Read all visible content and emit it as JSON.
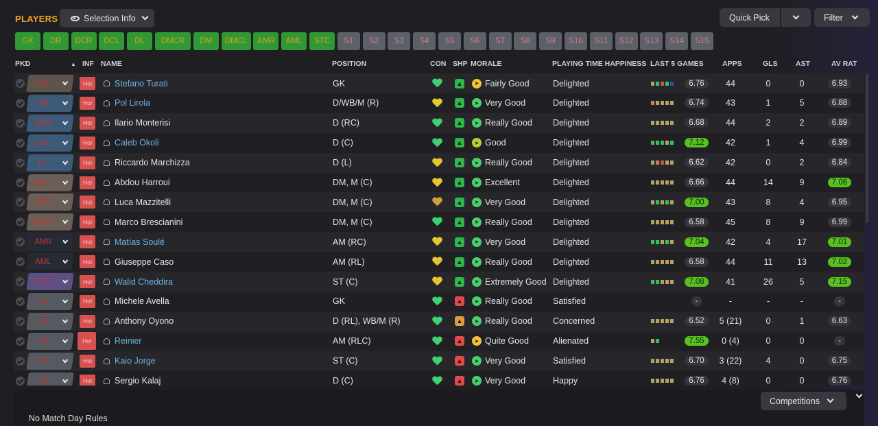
{
  "header": {
    "title": "PLAYERS",
    "selection_info": "Selection Info",
    "quick_pick": "Quick Pick",
    "filter": "Filter"
  },
  "slots": [
    "GK",
    "DR",
    "DCR",
    "DCL",
    "DL",
    "DMCR",
    "DM",
    "DMCL",
    "AMR",
    "AML",
    "STC",
    "S1",
    "S2",
    "S3",
    "S4",
    "S5",
    "S6",
    "S7",
    "S8",
    "S9",
    "S10",
    "S11",
    "S12",
    "S13",
    "S14",
    "S15"
  ],
  "columns": {
    "pkd": "PKD",
    "inf": "INF",
    "name": "NAME",
    "position": "POSITION",
    "con": "CON",
    "shp": "SHP",
    "morale": "MORALE",
    "pth": "PLAYING TIME HAPPINESS",
    "last5": "LAST 5 GAMES",
    "apps": "APPS",
    "gls": "GLS",
    "ast": "AST",
    "avrat": "AV RAT"
  },
  "players": [
    {
      "pkd": "GK",
      "inf": "Hol",
      "name": "Stefano Turati",
      "link": true,
      "position": "GK",
      "con": "g",
      "shp": "g",
      "morale_icon": "y",
      "morale": "Fairly Good",
      "pth": "Delighted",
      "bars": [
        "bt",
        "bg",
        "br",
        "bg",
        "bb"
      ],
      "form": "6.76",
      "apps": "44",
      "gls": "0",
      "ast": "0",
      "avrat": "6.93",
      "pos_bg": "#5e544c"
    },
    {
      "pkd": "DR",
      "inf": "Hol",
      "name": "Pol Lirola",
      "link": true,
      "position": "D/WB/M (R)",
      "con": "y",
      "shp": "g",
      "morale_icon": "g",
      "morale": "Very Good",
      "pth": "Delighted",
      "bars": [
        "bo",
        "bt",
        "bt",
        "bt",
        "bt"
      ],
      "form": "6.74",
      "apps": "43",
      "gls": "1",
      "ast": "5",
      "avrat": "6.88",
      "pos_bg": "#3d5a78"
    },
    {
      "pkd": "DCR",
      "inf": "Hol",
      "name": "Ilario Monterisi",
      "link": false,
      "position": "D (RC)",
      "con": "yg",
      "shp": "g",
      "morale_icon": "g",
      "morale": "Really Good",
      "pth": "Delighted",
      "bars": [
        "bt",
        "bt",
        "bt",
        "bt",
        "bt"
      ],
      "form": "6.68",
      "apps": "44",
      "gls": "2",
      "ast": "2",
      "avrat": "6.89",
      "pos_bg": "#3d5a78"
    },
    {
      "pkd": "DCL",
      "inf": "Hol",
      "name": "Caleb Okoli",
      "link": true,
      "position": "D (C)",
      "con": "g",
      "shp": "g",
      "morale_icon": "yg",
      "morale": "Good",
      "pth": "Delighted",
      "bars": [
        "bg",
        "bg",
        "bg",
        "bt",
        "bg"
      ],
      "form": "7.12",
      "form_hi": true,
      "apps": "42",
      "gls": "1",
      "ast": "4",
      "avrat": "6.99",
      "pos_bg": "#3d5a78"
    },
    {
      "pkd": "DL",
      "inf": "Hol",
      "name": "Riccardo Marchizza",
      "link": false,
      "position": "D (L)",
      "con": "y",
      "shp": "g",
      "morale_icon": "g",
      "morale": "Really Good",
      "pth": "Delighted",
      "bars": [
        "bt",
        "bo",
        "br",
        "bt",
        "bt"
      ],
      "form": "6.62",
      "apps": "42",
      "gls": "0",
      "ast": "2",
      "avrat": "6.84",
      "pos_bg": "#3d5a78"
    },
    {
      "pkd": "DM...",
      "inf": "Hol",
      "name": "Abdou Harroui",
      "link": false,
      "position": "DM, M (C)",
      "con": "y",
      "shp": "g",
      "morale_icon": "g",
      "morale": "Excellent",
      "pth": "Delighted",
      "bars": [
        "bt",
        "bt",
        "bt",
        "bt",
        "bt"
      ],
      "form": "6.66",
      "apps": "44",
      "gls": "14",
      "ast": "9",
      "avrat": "7.06",
      "avrat_hi": true,
      "pos_bg": "#6a5e58"
    },
    {
      "pkd": "DM",
      "inf": "Hol",
      "name": "Luca Mazzitelli",
      "link": false,
      "position": "DM, M (C)",
      "con": "o",
      "shp": "g",
      "morale_icon": "g",
      "morale": "Very Good",
      "pth": "Delighted",
      "bars": [
        "bt",
        "bg",
        "bt",
        "bg",
        "bt"
      ],
      "form": "7.00",
      "form_hi": true,
      "apps": "43",
      "gls": "8",
      "ast": "4",
      "avrat": "6.95",
      "pos_bg": "#6a5e58"
    },
    {
      "pkd": "DMCL",
      "inf": "Hol",
      "name": "Marco Brescianini",
      "link": false,
      "position": "DM, M (C)",
      "con": "yg",
      "shp": "g",
      "morale_icon": "g",
      "morale": "Really Good",
      "pth": "Delighted",
      "bars": [
        "bt",
        "bt",
        "bt",
        "bt",
        "bt"
      ],
      "form": "6.58",
      "apps": "45",
      "gls": "8",
      "ast": "9",
      "avrat": "6.99",
      "pos_bg": "#6a5e58"
    },
    {
      "pkd": "AMR",
      "inf": "Hol",
      "name": "Matías Soulé",
      "link": true,
      "position": "AM (RC)",
      "con": "y",
      "shp": "g",
      "morale_icon": "g",
      "morale": "Very Good",
      "pth": "Delighted",
      "bars": [
        "bg",
        "bg",
        "bt",
        "bg",
        "bt"
      ],
      "form": "7.04",
      "form_hi": true,
      "apps": "42",
      "gls": "4",
      "ast": "17",
      "avrat": "7.01",
      "avrat_hi": true,
      "pos_bg": "#262a34"
    },
    {
      "pkd": "AML",
      "inf": "Hol",
      "name": "Giuseppe Caso",
      "link": false,
      "position": "AM (RL)",
      "con": "y",
      "shp": "g",
      "morale_icon": "g",
      "morale": "Really Good",
      "pth": "Delighted",
      "bars": [
        "bt",
        "bt",
        "bt",
        "bt",
        "bt"
      ],
      "form": "6.58",
      "apps": "44",
      "gls": "11",
      "ast": "13",
      "avrat": "7.02",
      "avrat_hi": true,
      "pos_bg": "#262a34"
    },
    {
      "pkd": "STC",
      "inf": "Hol",
      "name": "Walid Cheddira",
      "link": true,
      "position": "ST (C)",
      "con": "y",
      "shp": "g",
      "morale_icon": "g",
      "morale": "Extremely Good",
      "pth": "Delighted",
      "bars": [
        "bg",
        "bg",
        "bt",
        "bt",
        "bt"
      ],
      "form": "7.08",
      "form_hi": true,
      "apps": "41",
      "gls": "26",
      "ast": "5",
      "avrat": "7.15",
      "avrat_hi": true,
      "pos_bg": "#5e4f82"
    },
    {
      "pkd": "S1",
      "inf": "Hol",
      "name": "Michele Avella",
      "link": false,
      "position": "GK",
      "con": "g",
      "shp": "r",
      "morale_icon": "g",
      "morale": "Really Good",
      "pth": "Satisfied",
      "bars": [],
      "form": "-",
      "apps": "-",
      "gls": "-",
      "ast": "-",
      "avrat": "-",
      "pos_bg": "#555960"
    },
    {
      "pkd": "S2",
      "inf": "Hol",
      "name": "Anthony Oyono",
      "link": false,
      "position": "D (RL), WB/M (R)",
      "con": "g",
      "shp": "o",
      "morale_icon": "g",
      "morale": "Really Good",
      "pth": "Concerned",
      "bars": [
        "bt",
        "bt",
        "bt",
        "bt",
        "bt"
      ],
      "form": "6.52",
      "apps": "5 (21)",
      "gls": "0",
      "ast": "1",
      "avrat": "6.63",
      "pos_bg": "#555960"
    },
    {
      "pkd": "S3",
      "inf": "Hol",
      "name": "Reinier",
      "link": true,
      "position": "AM (RLC)",
      "con": "g",
      "shp": "r",
      "morale_icon": "y",
      "morale": "Quite Good",
      "pth": "Alienated",
      "bars": [
        "bt",
        "bg"
      ],
      "form": "7.55",
      "form_hi": true,
      "apps": "0 (4)",
      "gls": "0",
      "ast": "0",
      "avrat": "-",
      "pos_bg": "#555960",
      "hol_big": true
    },
    {
      "pkd": "S4",
      "inf": "Hol",
      "name": "Kaio Jorge",
      "link": true,
      "position": "ST (C)",
      "con": "g",
      "shp": "r",
      "morale_icon": "g",
      "morale": "Very Good",
      "pth": "Satisfied",
      "bars": [
        "bt",
        "bt",
        "bt",
        "bt",
        "bt"
      ],
      "form": "6.70",
      "apps": "3 (22)",
      "gls": "4",
      "ast": "0",
      "avrat": "6.75",
      "pos_bg": "#555960"
    },
    {
      "pkd": "S5",
      "inf": "Hol",
      "name": "Sergio Kalaj",
      "link": false,
      "position": "D (C)",
      "con": "g",
      "shp": "r",
      "morale_icon": "g",
      "morale": "Very Good",
      "pth": "Happy",
      "bars": [
        "bt",
        "bt",
        "bt",
        "bt",
        "bt"
      ],
      "form": "6.76",
      "apps": "4 (8)",
      "gls": "0",
      "ast": "0",
      "avrat": "6.76",
      "pos_bg": "#555960"
    }
  ],
  "footer": {
    "competitions": "Competitions",
    "rules": "No Match Day Rules"
  }
}
